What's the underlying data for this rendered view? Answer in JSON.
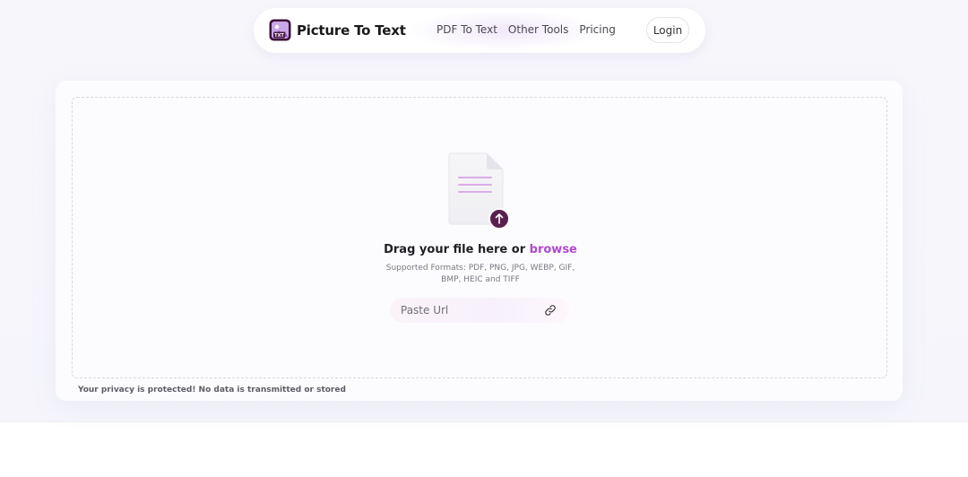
{
  "navbar": {
    "brand_name": "Picture To Text",
    "links": [
      {
        "label": "PDF To Text"
      },
      {
        "label": "Other Tools"
      },
      {
        "label": "Pricing"
      }
    ],
    "login_label": "Login",
    "logo_badge": "TXT"
  },
  "upload": {
    "drag_text": "Drag your file here or ",
    "browse_label": "browse",
    "formats_text": "Supported Formats: PDF, PNG, JPG, WEBP, GIF, BMP, HEIC and TIFF",
    "url_placeholder": "Paste Url",
    "privacy_note": "Your privacy is protected! No data is transmitted or stored"
  },
  "colors": {
    "accent": "#b14ad0",
    "upload_badge": "#5a1f4f",
    "file_lines": "#d8aee6"
  },
  "icons": [
    "app-logo-icon",
    "file-icon",
    "upload-arrow-icon",
    "link-icon"
  ]
}
